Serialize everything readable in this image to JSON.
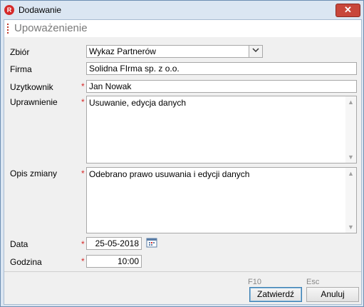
{
  "window": {
    "title": "Dodawanie",
    "app_icon_letter": "R",
    "close_glyph": "✕"
  },
  "section": {
    "title": "Upoważenienie"
  },
  "form": {
    "zbior": {
      "label": "Zbiór",
      "value": "Wykaz Partnerów"
    },
    "firma": {
      "label": "Firma",
      "value": "Solidna FIrma sp. z o.o."
    },
    "uzytkownik": {
      "label": "Uzytkownik",
      "value": "Jan Nowak",
      "required": "*"
    },
    "uprawnienie": {
      "label": "Uprawnienie",
      "value": "Usuwanie, edycja danych",
      "required": "*"
    },
    "opis_zmiany": {
      "label": "Opis zmiany",
      "value": "Odebrano prawo usuwania i edycji danych",
      "required": "*"
    },
    "data": {
      "label": "Data",
      "value": "25-05-2018",
      "required": "*"
    },
    "godzina": {
      "label": "Godzina",
      "value": "10:00",
      "required": "*"
    }
  },
  "footer": {
    "confirm": {
      "hotkey": "F10",
      "label": "Zatwierdź"
    },
    "cancel": {
      "hotkey": "Esc",
      "label": "Anuluj"
    }
  },
  "icons": {
    "dropdown": "chevron-down-icon",
    "calendar": "calendar-icon",
    "scroll_up": "scroll-up-icon",
    "scroll_down": "scroll-down-icon"
  },
  "colors": {
    "accent_red": "#d62a2a",
    "frame": "#dbe6f2",
    "close_button": "#c8473b",
    "primary_button_border": "#3c7fb1"
  }
}
